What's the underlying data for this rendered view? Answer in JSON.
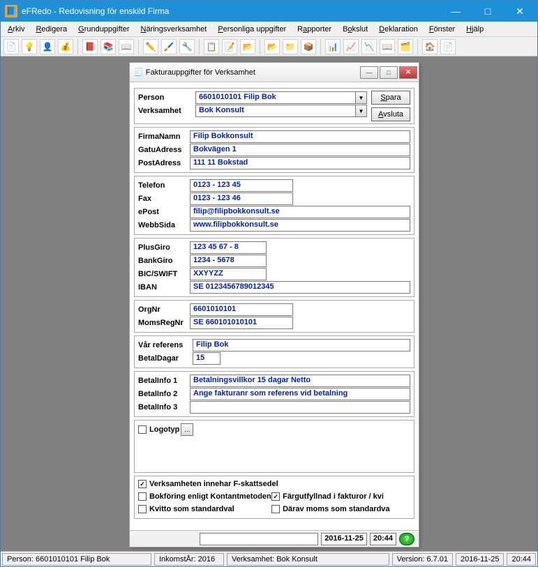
{
  "window": {
    "title": "eFRedo - Redovisning för enskild Firma"
  },
  "menu": {
    "arkiv": "Arkiv",
    "redigera": "Redigera",
    "grunduppgifter": "Grunduppgifter",
    "naringsverksamhet": "Näringsverksamhet",
    "personliga": "Personliga uppgifter",
    "rapporter": "Rapporter",
    "bokslut": "Bokslut",
    "deklaration": "Deklaration",
    "fonster": "Fönster",
    "hjalp": "Hjälp"
  },
  "dialog": {
    "title": "Fakturauppgifter för Verksamhet",
    "labels": {
      "person": "Person",
      "verksamhet": "Verksamhet",
      "firmanamn": "FirmaNamn",
      "gatuadress": "GatuAdress",
      "postadress": "PostAdress",
      "telefon": "Telefon",
      "fax": "Fax",
      "epost": "ePost",
      "webbsida": "WebbSida",
      "plusgiro": "PlusGiro",
      "bankgiro": "BankGiro",
      "bicswift": "BIC/SWIFT",
      "iban": "IBAN",
      "orgnr": "OrgNr",
      "momsregnr": "MomsRegNr",
      "varreferens": "Vår referens",
      "betaldagar": "BetalDagar",
      "betalinfo1": "BetalInfo 1",
      "betalinfo2": "BetalInfo 2",
      "betalinfo3": "BetalInfo 3",
      "logotyp": "Logotyp"
    },
    "values": {
      "person": "6601010101     Filip Bok",
      "verksamhet": "Bok Konsult",
      "firmanamn": "Filip Bokkonsult",
      "gatuadress": "Bokvägen 1",
      "postadress": "111 11 Bokstad",
      "telefon": "0123 - 123 45",
      "fax": "0123 - 123 46",
      "epost": "filip@filipbokkonsult.se",
      "webbsida": "www.filipbokkonsult.se",
      "plusgiro": "123 45 67 - 8",
      "bankgiro": "1234 - 5678",
      "bicswift": "XXYYZZ",
      "iban": "SE 0123456789012345",
      "orgnr": "6601010101",
      "momsregnr": "SE 660101010101",
      "varreferens": "Filip Bok",
      "betaldagar": "15",
      "betalinfo1": "Betalningsvillkor 15 dagar Netto",
      "betalinfo2": "Ange fakturanr som referens vid betalning",
      "betalinfo3": ""
    },
    "buttons": {
      "spara": "Spara",
      "avsluta": "Avsluta"
    },
    "checks": {
      "fskatt": "Verksamheten innehar F-skattsedel",
      "kontant": "Bokföring enligt Kontantmetoden",
      "farg": "Färgutfyllnad i fakturor / kvi",
      "kvitto": "Kvitto som standardval",
      "moms": "Därav moms som standardva"
    },
    "status": {
      "date": "2016-11-25",
      "time": "20:44"
    }
  },
  "statusbar": {
    "person": "Person: 6601010101  Filip Bok",
    "year": "InkomstÅr: 2016",
    "verksamhet": "Verksamhet: Bok Konsult",
    "version": "Version: 6.7.01",
    "date": "2016-11-25",
    "time": "20:44"
  }
}
